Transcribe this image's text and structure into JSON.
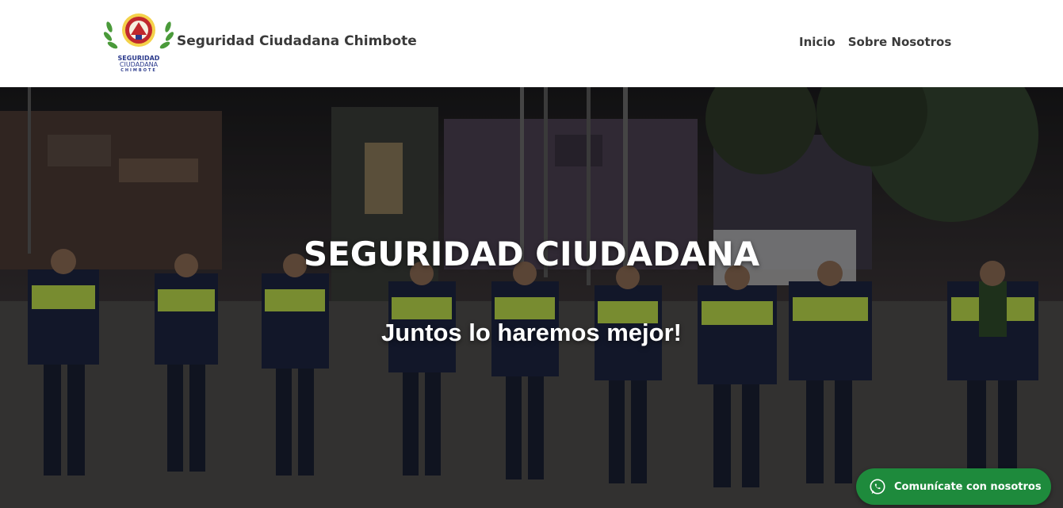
{
  "header": {
    "site_title": "Seguridad Ciudadana Chimbote",
    "logo": {
      "icon": "shield-emblem-icon",
      "line1": "SEGURIDAD",
      "line2": "CIUDADANA",
      "line3": "CHIMBOTE"
    },
    "nav": [
      {
        "label": "Inicio"
      },
      {
        "label": "Sobre Nosotros"
      }
    ]
  },
  "hero": {
    "title": "SEGURIDAD CIUDADANA",
    "subtitle": "Juntos lo haremos mejor!",
    "image": "night-photo-serenazgo-officers-in-line"
  },
  "whatsapp": {
    "icon": "whatsapp-icon",
    "label": "Comunícate con nosotros",
    "color": "#1e8a3c"
  },
  "colors": {
    "text_dark": "#3a3a3a",
    "logo_blue": "#2b3a8c",
    "logo_red": "#c0282d",
    "vest_green": "#b9d84a"
  }
}
